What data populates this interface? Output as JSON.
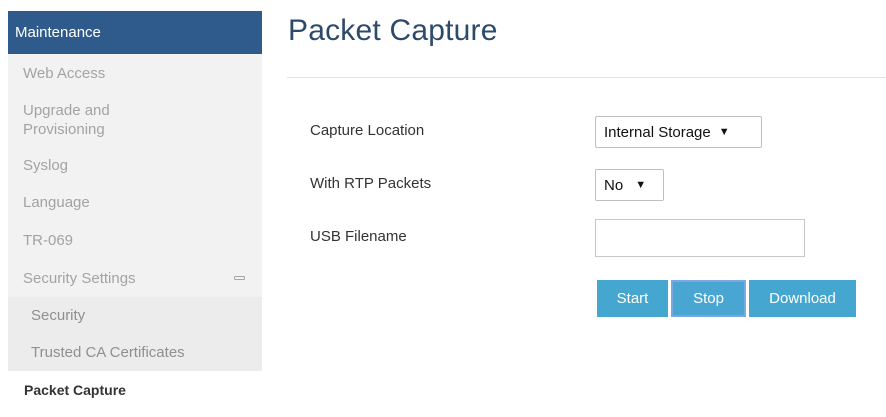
{
  "sidebar": {
    "header": "Maintenance",
    "items": [
      {
        "label": "Web Access"
      },
      {
        "label": "Upgrade and\nProvisioning"
      },
      {
        "label": "Syslog"
      },
      {
        "label": "Language"
      },
      {
        "label": "TR-069"
      },
      {
        "label": "Security Settings"
      }
    ],
    "sub_items": [
      {
        "label": "Security"
      },
      {
        "label": "Trusted CA Certificates"
      }
    ],
    "active_item": "Packet Capture"
  },
  "main": {
    "title": "Packet Capture",
    "fields": {
      "capture_location": {
        "label": "Capture Location",
        "value": "Internal Storage"
      },
      "rtp_packets": {
        "label": "With RTP Packets",
        "value": "No"
      },
      "usb_filename": {
        "label": "USB Filename",
        "value": "",
        "placeholder": ""
      }
    },
    "buttons": {
      "start": "Start",
      "stop": "Stop",
      "download": "Download"
    }
  },
  "colors": {
    "sidebar_header_bg": "#2e5a8c",
    "button_bg": "#45a7cf",
    "title_color": "#2e4a6b"
  }
}
